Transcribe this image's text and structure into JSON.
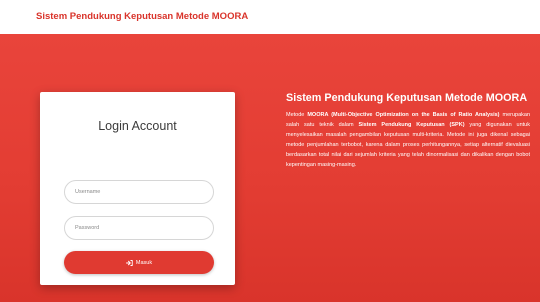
{
  "header": {
    "brand": "Sistem Pendukung Keputusan Metode MOORA"
  },
  "login": {
    "title": "Login Account",
    "username_placeholder": "Username",
    "password_placeholder": "Password",
    "submit_label": "Masuk",
    "submit_icon": "sign-in-icon"
  },
  "info": {
    "title": "Sistem Pendukung Keputusan Metode MOORA",
    "desc": {
      "t1": "Metode ",
      "b1": "MOORA (Multi-Objective Optimization on the Basis of Ratio Analysis)",
      "t2": " merupakan salah satu teknik dalam ",
      "b2": "Sistem Pendukung Keputusan (SPK)",
      "t3": " yang digunakan untuk menyelesaikan masalah pengambilan keputusan multi-kriteria. Metode ini juga dikenal sebagai metode penjumlahan terbobot, karena dalam proses perhitungannya, setiap alternatif dievaluasi berdasarkan total nilai dari sejumlah kriteria yang telah dinormalisasi dan dikalikan dengan bobot kepentingan masing-masing."
    }
  },
  "colors": {
    "accent": "#e03a31",
    "brand_text": "#d9342b",
    "card_bg": "#ffffff"
  }
}
